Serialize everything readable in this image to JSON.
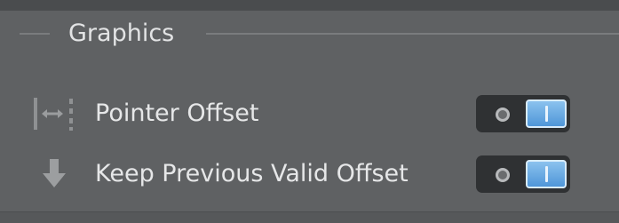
{
  "group": {
    "title": "Graphics"
  },
  "settings": [
    {
      "label": "Pointer Offset",
      "icon": "pointer-offset-icon",
      "enabled": true
    },
    {
      "label": "Keep Previous Valid Offset",
      "icon": "arrow-down-icon",
      "enabled": true
    }
  ],
  "colors": {
    "panel_bg": "#5f6163",
    "text": "#e6e7e8",
    "toggle_on": "#5fa3df"
  }
}
